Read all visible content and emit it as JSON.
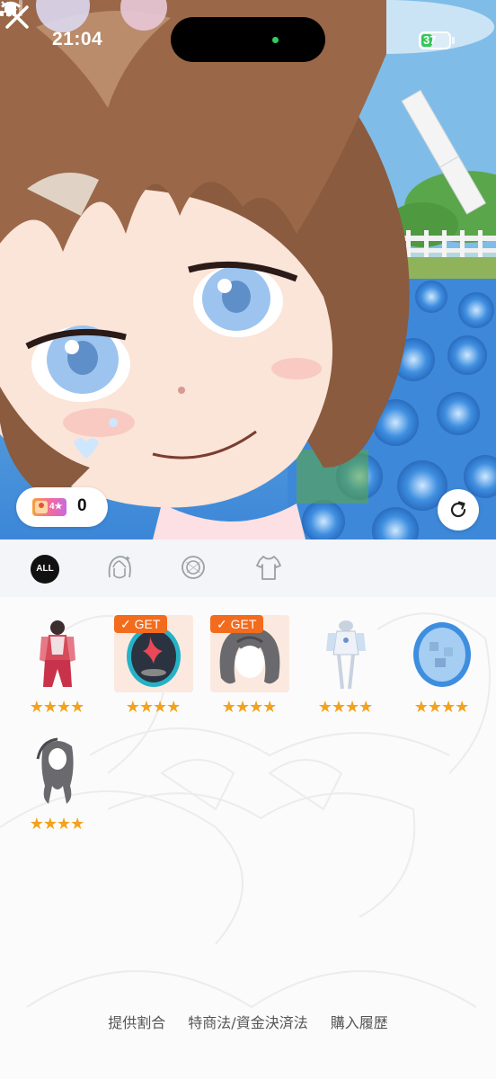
{
  "status_bar": {
    "time": "21:04",
    "battery_level": "37",
    "icons": [
      "bell-slash-icon",
      "cellular-signal-icon",
      "wifi-icon",
      "battery-icon"
    ]
  },
  "hero": {
    "close_icon": "close-icon",
    "refresh_icon": "refresh-icon",
    "point_badge_label": "4★",
    "point_count": "0"
  },
  "tabs": [
    {
      "label": "ALL",
      "icon": "all-icon",
      "selected": true
    },
    {
      "label": "",
      "icon": "hair-icon",
      "selected": false
    },
    {
      "label": "",
      "icon": "accessory-ring-icon",
      "selected": false
    },
    {
      "label": "",
      "icon": "outfit-icon",
      "selected": false
    }
  ],
  "items": [
    {
      "type": "outfit",
      "rarity": "★★★★",
      "owned": false
    },
    {
      "type": "accessory",
      "rarity": "★★★★",
      "owned": true
    },
    {
      "type": "hair",
      "rarity": "★★★★",
      "owned": true
    },
    {
      "type": "outfit",
      "rarity": "★★★★",
      "owned": false
    },
    {
      "type": "accessory",
      "rarity": "★★★★",
      "owned": false
    },
    {
      "type": "hair",
      "rarity": "★★★★",
      "owned": false
    }
  ],
  "get_badge_label": "✓ GET",
  "footer": {
    "link1": "提供割合",
    "link2": "特商法/資金決済法",
    "link3": "購入履歴"
  },
  "colors": {
    "accent_orange": "#f36b1c",
    "star_gold": "#f2a21e",
    "tab_selected": "#111111"
  }
}
